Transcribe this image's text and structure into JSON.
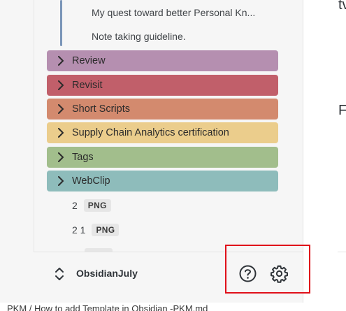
{
  "sidebar": {
    "notes": [
      {
        "label": "My quest toward better Personal Kn..."
      },
      {
        "label": "Note taking guideline."
      }
    ],
    "folders": [
      {
        "label": "Review",
        "color": "#b58fb0"
      },
      {
        "label": "Revisit",
        "color": "#c15f6a"
      },
      {
        "label": "Short Scripts",
        "color": "#d38a6e"
      },
      {
        "label": "Supply Chain Analytics certification",
        "color": "#ebcd8c"
      },
      {
        "label": "Tags",
        "color": "#a2be8c"
      },
      {
        "label": "WebClip",
        "color": "#8ebcbb"
      }
    ],
    "files": [
      {
        "name": "2",
        "badge": "PNG"
      },
      {
        "name": "2 1",
        "badge": "PNG"
      }
    ]
  },
  "vault": {
    "name": "ObsidianJuly",
    "switch_icon": "chevron-up-down-icon"
  },
  "actions": {
    "help_icon": "help-circle-icon",
    "settings_icon": "gear-icon",
    "highlight_color": "#e0101a"
  },
  "status_bar": {
    "path": "PKM / How to add Template in Obsidian -PKM.md"
  },
  "editor": {
    "fragment_1": "tv",
    "fragment_2": "F"
  }
}
